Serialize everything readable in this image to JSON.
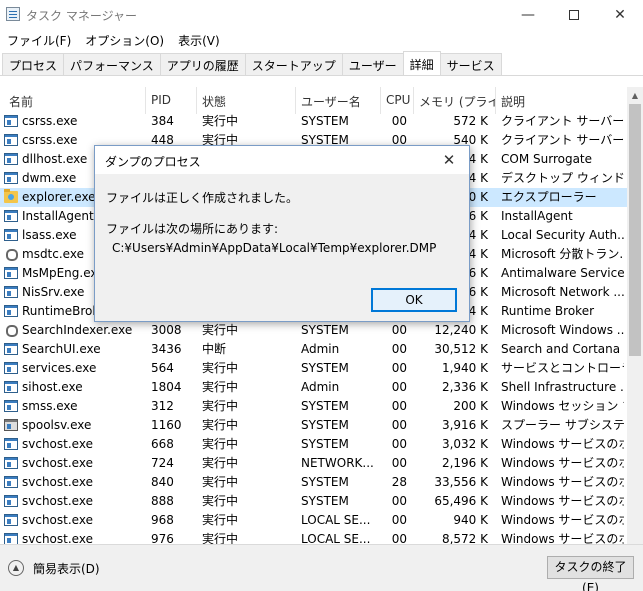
{
  "window": {
    "title": "タスク マネージャー",
    "minimize_glyph": "—",
    "close_glyph": "✕"
  },
  "menu": [
    {
      "label": "ファイル(F)"
    },
    {
      "label": "オプション(O)"
    },
    {
      "label": "表示(V)"
    }
  ],
  "tabs": [
    {
      "label": "プロセス"
    },
    {
      "label": "パフォーマンス"
    },
    {
      "label": "アプリの履歴"
    },
    {
      "label": "スタートアップ"
    },
    {
      "label": "ユーザー"
    },
    {
      "label": "詳細",
      "active": true
    },
    {
      "label": "サービス"
    }
  ],
  "columns": {
    "name": "名前",
    "pid": "PID",
    "status": "状態",
    "user": "ユーザー名",
    "cpu": "CPU",
    "mem": "メモリ (プライ...",
    "desc": "説明"
  },
  "rows": [
    {
      "name": "csrss.exe",
      "pid": "384",
      "status": "実行中",
      "user": "SYSTEM",
      "cpu": "00",
      "mem": "572 K",
      "desc": "クライアント サーバー ラ...",
      "icon": "app-icon"
    },
    {
      "name": "csrss.exe",
      "pid": "448",
      "status": "実行中",
      "user": "SYSTEM",
      "cpu": "00",
      "mem": "540 K",
      "desc": "クライアント サーバー ラ...",
      "icon": "app-icon"
    },
    {
      "name": "dllhost.exe",
      "pid": "",
      "status": "",
      "user": "",
      "cpu": "",
      "mem": "4 K",
      "desc": "COM Surrogate",
      "icon": "app-icon"
    },
    {
      "name": "dwm.exe",
      "pid": "",
      "status": "",
      "user": "",
      "cpu": "",
      "mem": "4 K",
      "desc": "デスクトップ ウィンドウ マ...",
      "icon": "app-icon"
    },
    {
      "name": "explorer.exe",
      "pid": "",
      "status": "",
      "user": "",
      "cpu": "",
      "mem": "0 K",
      "desc": "エクスプローラー",
      "icon": "explorer-icon",
      "selected": true
    },
    {
      "name": "InstallAgent.exe",
      "pid": "",
      "status": "",
      "user": "",
      "cpu": "",
      "mem": "6 K",
      "desc": "InstallAgent",
      "icon": "app-icon"
    },
    {
      "name": "lsass.exe",
      "pid": "",
      "status": "",
      "user": "",
      "cpu": "",
      "mem": "4 K",
      "desc": "Local Security Auth...",
      "icon": "app-icon"
    },
    {
      "name": "msdtc.exe",
      "pid": "",
      "status": "",
      "user": "",
      "cpu": "",
      "mem": "4 K",
      "desc": "Microsoft 分散トラン...",
      "icon": "search-icon"
    },
    {
      "name": "MsMpEng.exe",
      "pid": "",
      "status": "",
      "user": "",
      "cpu": "",
      "mem": "6 K",
      "desc": "Antimalware Service...",
      "icon": "app-icon"
    },
    {
      "name": "NisSrv.exe",
      "pid": "",
      "status": "",
      "user": "",
      "cpu": "",
      "mem": "6 K",
      "desc": "Microsoft Network ...",
      "icon": "app-icon"
    },
    {
      "name": "RuntimeBroker",
      "pid": "",
      "status": "",
      "user": "",
      "cpu": "",
      "mem": "4 K",
      "desc": "Runtime Broker",
      "icon": "app-icon"
    },
    {
      "name": "SearchIndexer.exe",
      "pid": "3008",
      "status": "実行中",
      "user": "SYSTEM",
      "cpu": "00",
      "mem": "12,240 K",
      "desc": "Microsoft Windows ...",
      "icon": "search-icon"
    },
    {
      "name": "SearchUI.exe",
      "pid": "3436",
      "status": "中断",
      "user": "Admin",
      "cpu": "00",
      "mem": "30,512 K",
      "desc": "Search and Cortana ...",
      "icon": "app-icon"
    },
    {
      "name": "services.exe",
      "pid": "564",
      "status": "実行中",
      "user": "SYSTEM",
      "cpu": "00",
      "mem": "1,940 K",
      "desc": "サービスとコントローラー ...",
      "icon": "app-icon"
    },
    {
      "name": "sihost.exe",
      "pid": "1804",
      "status": "実行中",
      "user": "Admin",
      "cpu": "00",
      "mem": "2,336 K",
      "desc": "Shell Infrastructure ...",
      "icon": "app-icon"
    },
    {
      "name": "smss.exe",
      "pid": "312",
      "status": "実行中",
      "user": "SYSTEM",
      "cpu": "00",
      "mem": "200 K",
      "desc": "Windows セッション マ...",
      "icon": "app-icon"
    },
    {
      "name": "spoolsv.exe",
      "pid": "1160",
      "status": "実行中",
      "user": "SYSTEM",
      "cpu": "00",
      "mem": "3,916 K",
      "desc": "スプーラー サブシステム ...",
      "icon": "printer-icon"
    },
    {
      "name": "svchost.exe",
      "pid": "668",
      "status": "実行中",
      "user": "SYSTEM",
      "cpu": "00",
      "mem": "3,032 K",
      "desc": "Windows サービスのホ...",
      "icon": "app-icon"
    },
    {
      "name": "svchost.exe",
      "pid": "724",
      "status": "実行中",
      "user": "NETWORK...",
      "cpu": "00",
      "mem": "2,196 K",
      "desc": "Windows サービスのホ...",
      "icon": "app-icon"
    },
    {
      "name": "svchost.exe",
      "pid": "840",
      "status": "実行中",
      "user": "SYSTEM",
      "cpu": "28",
      "mem": "33,556 K",
      "desc": "Windows サービスのホ...",
      "icon": "app-icon"
    },
    {
      "name": "svchost.exe",
      "pid": "888",
      "status": "実行中",
      "user": "SYSTEM",
      "cpu": "00",
      "mem": "65,496 K",
      "desc": "Windows サービスのホ...",
      "icon": "app-icon"
    },
    {
      "name": "svchost.exe",
      "pid": "968",
      "status": "実行中",
      "user": "LOCAL SE...",
      "cpu": "00",
      "mem": "940 K",
      "desc": "Windows サービスのホ...",
      "icon": "app-icon"
    },
    {
      "name": "svchost.exe",
      "pid": "976",
      "status": "実行中",
      "user": "LOCAL SE...",
      "cpu": "00",
      "mem": "8,572 K",
      "desc": "Windows サービスのホ...",
      "icon": "app-icon"
    }
  ],
  "footer": {
    "fewer_details": "簡易表示(D)",
    "end_task": "タスクの終了(E)"
  },
  "dialog": {
    "title": "ダンプのプロセス",
    "message": "ファイルは正しく作成されました。",
    "location_label": "ファイルは次の場所にあります:",
    "path": "C:¥Users¥Admin¥AppData¥Local¥Temp¥explorer.DMP",
    "ok": "OK"
  }
}
